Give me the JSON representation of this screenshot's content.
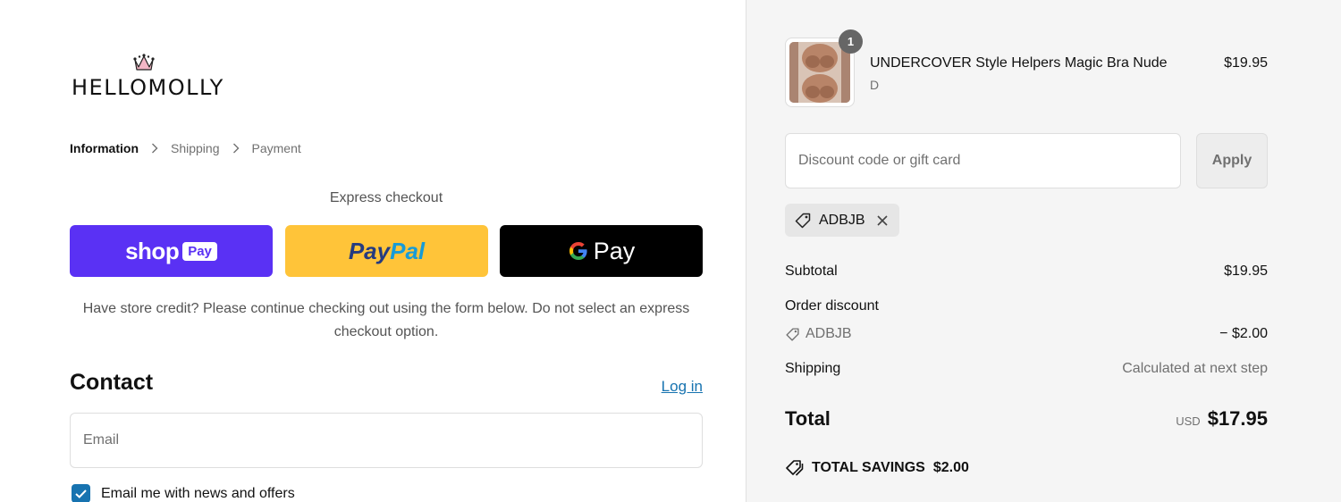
{
  "brand": {
    "name": "HELLOMOLLY",
    "logo_icon": "crown-icon"
  },
  "breadcrumb": {
    "items": [
      "Information",
      "Shipping",
      "Payment"
    ],
    "separator_icon": "chevron-right-icon"
  },
  "express": {
    "title": "Express checkout",
    "buttons": [
      {
        "name": "Shop Pay",
        "shop_text": "shop",
        "pill_text": "Pay",
        "color": "#5a31f4"
      },
      {
        "name": "PayPal",
        "text_1": "Pay",
        "text_2": "Pal",
        "color": "#ffc439"
      },
      {
        "name": "Google Pay",
        "text": "Pay",
        "color": "#000000"
      }
    ],
    "note": "Have store credit? Please continue checking out using the form below. Do not select an express checkout option."
  },
  "contact": {
    "title": "Contact",
    "login_label": "Log in",
    "email_placeholder": "Email",
    "newsletter_label": "Email me with news and offers",
    "newsletter_checked": true
  },
  "cart": {
    "items": [
      {
        "name": "UNDERCOVER Style Helpers Magic Bra Nude",
        "variant": "D",
        "price": "$19.95",
        "quantity": "1"
      }
    ]
  },
  "discount": {
    "placeholder": "Discount code or gift card",
    "apply_label": "Apply",
    "applied_code": "ADBJB",
    "tag_icon": "tag-icon",
    "remove_icon": "close-icon"
  },
  "summary": {
    "subtotal_label": "Subtotal",
    "subtotal_value": "$19.95",
    "order_discount_label": "Order discount",
    "discount_code": "ADBJB",
    "discount_value": "− $2.00",
    "shipping_label": "Shipping",
    "shipping_value": "Calculated at next step",
    "total_label": "Total",
    "currency": "USD",
    "total_value": "$17.95",
    "savings_label": "TOTAL SAVINGS",
    "savings_value": "$2.00"
  },
  "colors": {
    "accent": "#1773b0",
    "shop_pay": "#5a31f4",
    "paypal": "#ffc439"
  }
}
